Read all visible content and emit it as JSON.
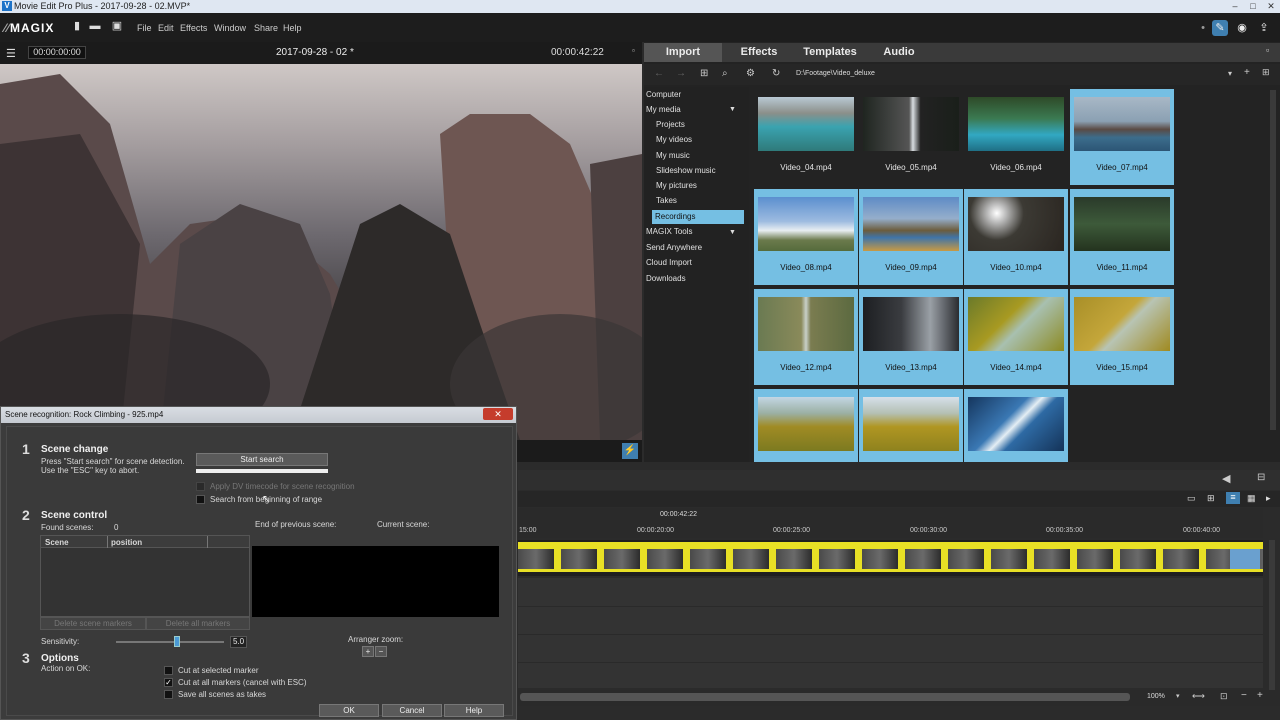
{
  "window": {
    "title": "Movie Edit Pro Plus - 2017-09-28 - 02.MVP*",
    "app_icon": "V"
  },
  "menubar": {
    "logo": "MAGIX",
    "items": [
      "File",
      "Edit",
      "Effects",
      "Window",
      "Share",
      "Help"
    ]
  },
  "preview": {
    "timecode_left": "00:00:00:00",
    "project_title": "2017-09-28 - 02 *",
    "timecode_right": "00:00:42:22"
  },
  "media_panel": {
    "tabs": [
      "Import",
      "Effects",
      "Templates",
      "Audio"
    ],
    "path": "D:\\Footage\\Video_deluxe",
    "tree": [
      "Computer",
      "My media",
      "Projects",
      "My videos",
      "My music",
      "Slideshow music",
      "My pictures",
      "Takes",
      "Recordings",
      "MAGIX Tools",
      "Send Anywhere",
      "Cloud Import",
      "Downloads"
    ],
    "selected_tree": "Recordings",
    "thumbnails": [
      {
        "label": "Video_04.mp4",
        "selected": false
      },
      {
        "label": "Video_05.mp4",
        "selected": false
      },
      {
        "label": "Video_06.mp4",
        "selected": false
      },
      {
        "label": "Video_07.mp4",
        "selected": true
      },
      {
        "label": "Video_08.mp4",
        "selected": true
      },
      {
        "label": "Video_09.mp4",
        "selected": true
      },
      {
        "label": "Video_10.mp4",
        "selected": true
      },
      {
        "label": "Video_11.mp4",
        "selected": true
      },
      {
        "label": "Video_12.mp4",
        "selected": true
      },
      {
        "label": "Video_13.mp4",
        "selected": true
      },
      {
        "label": "Video_14.mp4",
        "selected": true
      },
      {
        "label": "Video_15.mp4",
        "selected": true
      },
      {
        "label": "",
        "selected": true
      },
      {
        "label": "",
        "selected": true
      },
      {
        "label": "",
        "selected": true
      }
    ]
  },
  "timeline": {
    "marker": "00:00:42:22",
    "ruler": [
      "15:00",
      "00:00:20:00",
      "00:00:25:00",
      "00:00:30:00",
      "00:00:35:00",
      "00:00:40:00"
    ],
    "zoom": "100%"
  },
  "dialog": {
    "title": "Scene recognition: Rock Climbing - 925.mp4",
    "s1_num": "1",
    "s1_heading": "Scene change",
    "s1_text1": "Press \"Start search\" for scene detection.",
    "s1_text2": "Use the \"ESC\" key to abort.",
    "start_search": "Start search",
    "apply_dv": "Apply DV timecode for scene recognition",
    "search_from_beginning": "Search from beginning of range",
    "s2_num": "2",
    "s2_heading": "Scene control",
    "found_scenes_label": "Found scenes:",
    "found_scenes_value": "0",
    "end_prev_scene": "End of previous scene:",
    "current_scene": "Current scene:",
    "col_scene": "Scene",
    "col_position": "position",
    "delete_scene_markers": "Delete scene markers",
    "delete_all_markers": "Delete all markers",
    "sensitivity_label": "Sensitivity:",
    "sensitivity_value": "5.0",
    "arranger_zoom": "Arranger zoom:",
    "s3_num": "3",
    "s3_heading": "Options",
    "action_on_ok": "Action on OK:",
    "opt1": "Cut at selected marker",
    "opt2": "Cut at all markers (cancel with ESC)",
    "opt3": "Save all scenes as takes",
    "ok": "OK",
    "cancel": "Cancel",
    "help": "Help"
  }
}
